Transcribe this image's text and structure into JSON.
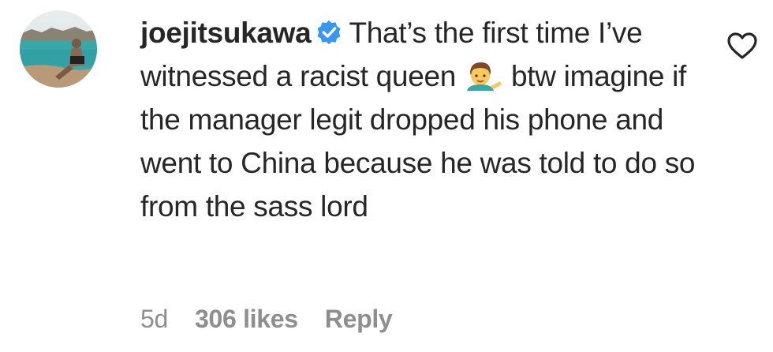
{
  "comment": {
    "username": "joejitsukawa",
    "verified": true,
    "text_part1": "That’s the first time I’ve witnessed a racist queen",
    "emoji": "man-tipping-hand-emoji",
    "text_part2": "btw imagine if the manager legit dropped his phone and went to China because he was told to do so from the sass lord",
    "age": "5d",
    "likes": "306 likes",
    "reply_label": "Reply"
  },
  "icons": {
    "verified": "verified-badge-icon",
    "like": "heart-icon"
  },
  "colors": {
    "text": "#262626",
    "meta": "#8e8e8e",
    "verified_blue": "#3897f0"
  }
}
